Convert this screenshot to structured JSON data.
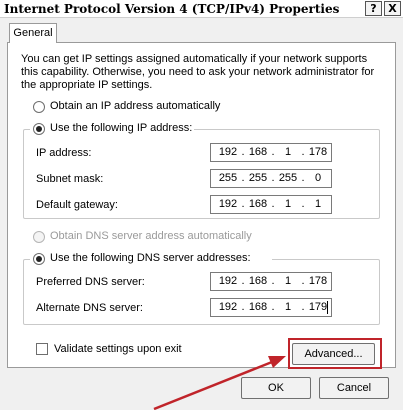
{
  "window": {
    "title": "Internet Protocol Version 4 (TCP/IPv4) Properties",
    "help_glyph": "?",
    "close_glyph": "X"
  },
  "tabs": [
    {
      "label": "General"
    }
  ],
  "intro_text": "You can get IP settings assigned automatically if your network supports this capability. Otherwise, you need to ask your network administrator for the appropriate IP settings.",
  "ip_mode": {
    "auto_label": "Obtain an IP address automatically",
    "manual_label": "Use the following IP address:",
    "selected": "manual"
  },
  "ip_fields": {
    "ip_address": {
      "label": "IP address:",
      "octets": [
        "192",
        "168",
        "1",
        "178"
      ]
    },
    "subnet_mask": {
      "label": "Subnet mask:",
      "octets": [
        "255",
        "255",
        "255",
        "0"
      ]
    },
    "default_gateway": {
      "label": "Default gateway:",
      "octets": [
        "192",
        "168",
        "1",
        "1"
      ]
    }
  },
  "dns_mode": {
    "auto_label": "Obtain DNS server address automatically",
    "manual_label": "Use the following DNS server addresses:",
    "selected": "manual"
  },
  "dns_fields": {
    "preferred": {
      "label": "Preferred DNS server:",
      "octets": [
        "192",
        "168",
        "1",
        "178"
      ]
    },
    "alternate": {
      "label": "Alternate DNS server:",
      "octets": [
        "192",
        "168",
        "1",
        "179"
      ]
    }
  },
  "validate": {
    "label": "Validate settings upon exit",
    "checked": false
  },
  "buttons": {
    "advanced": "Advanced...",
    "ok": "OK",
    "cancel": "Cancel"
  },
  "colors": {
    "annotation": "#c0242a"
  },
  "icons": {
    "annotation": "red-arrow-icon"
  }
}
